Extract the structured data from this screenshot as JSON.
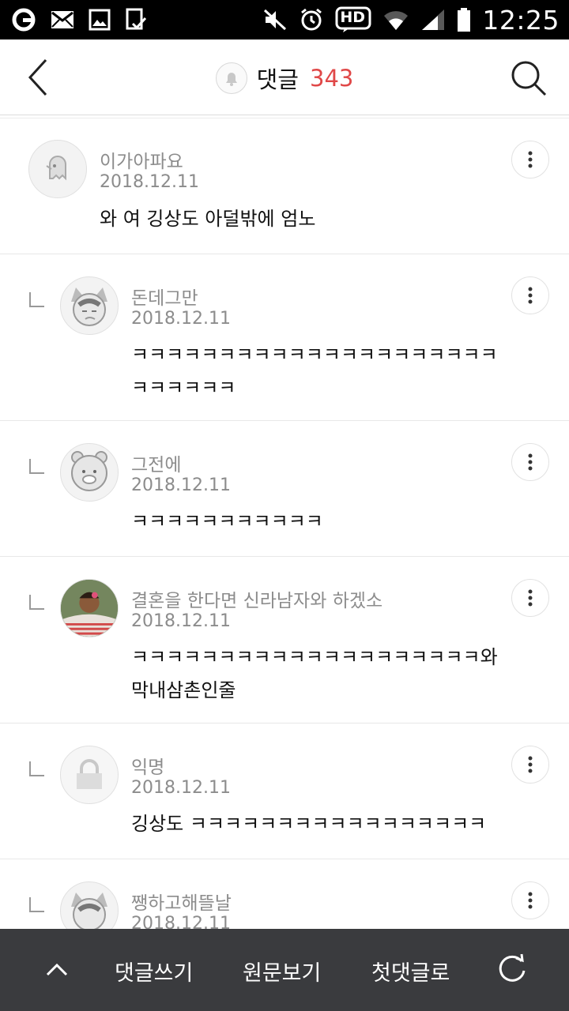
{
  "status_bar": {
    "time": "12:25",
    "hd_label": "HD"
  },
  "header": {
    "title": "댓글",
    "count": "343"
  },
  "comments": [
    {
      "name": "이가아파요",
      "date": "2018.12.11",
      "text": "와 여 깅상도 아덜밖에 엄노",
      "reply": false
    },
    {
      "name": "돈데그만",
      "date": "2018.12.11",
      "text": "ㅋㅋㅋㅋㅋㅋㅋㅋㅋㅋㅋㅋㅋㅋㅋㅋㅋㅋㅋㅋㅋㅋㅋㅋㅋㅋㅋ",
      "reply": true
    },
    {
      "name": "그전에",
      "date": "2018.12.11",
      "text": "ㅋㅋㅋㅋㅋㅋㅋㅋㅋㅋㅋ",
      "reply": true
    },
    {
      "name": "결혼을 한다면 신라남자와 하겠소",
      "date": "2018.12.11",
      "text": "ㅋㅋㅋㅋㅋㅋㅋㅋㅋㅋㅋㅋㅋㅋㅋㅋㅋㅋㅋㅋ와막내삼촌인줄",
      "reply": true
    },
    {
      "name": "익명",
      "date": "2018.12.11",
      "text": "깅상도 ㅋㅋㅋㅋㅋㅋㅋㅋㅋㅋㅋㅋㅋㅋㅋㅋㅋ",
      "reply": true
    },
    {
      "name": "쨍하고해뜰날",
      "date": "2018.12.11",
      "text": "",
      "reply": true
    }
  ],
  "bottom_bar": {
    "write_label": "댓글쓰기",
    "original_label": "원문보기",
    "first_label": "첫댓글로"
  },
  "colors": {
    "count_accent": "#e04848",
    "bottom_bar": "#3a3b3e",
    "meta_text": "#8c8c8c"
  },
  "icons": [
    "back-arrow-icon",
    "bell-icon",
    "search-icon",
    "more-vertical-icon",
    "reply-arrow-icon",
    "chevron-up-icon",
    "refresh-icon"
  ]
}
